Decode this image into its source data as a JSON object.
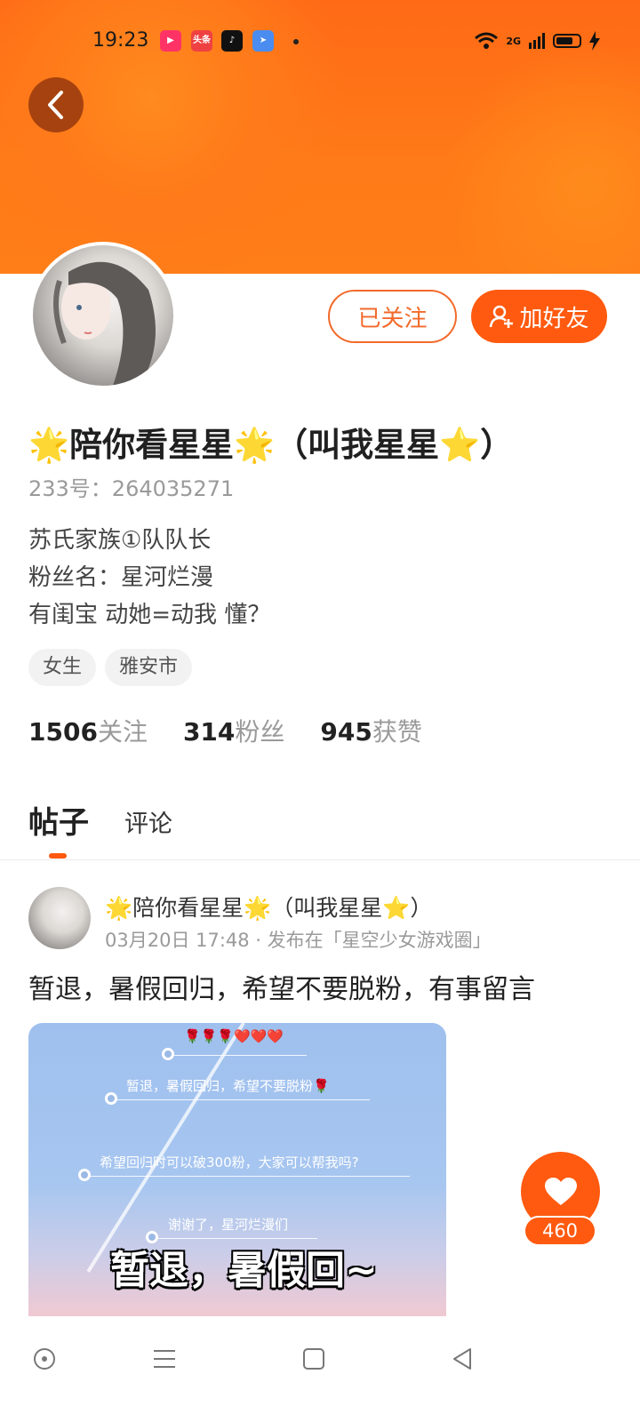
{
  "status_bar": {
    "time": "19:23",
    "network": "2G",
    "app_icons": [
      "video-app-icon",
      "toutiao-icon",
      "tiktok-icon",
      "maps-app-icon"
    ],
    "toutiao_label": "头条"
  },
  "profile": {
    "follow_button": "已关注",
    "add_friend_button": "加好友",
    "name": "🌟陪你看星星🌟（叫我星星⭐）",
    "uid": "233号：264035271",
    "bio": [
      "苏氏家族①队队长",
      "粉丝名：星河烂漫",
      "有闺宝 动她=动我 懂？"
    ],
    "tags": [
      "女生",
      "雅安市"
    ],
    "stats": [
      {
        "num": "1506",
        "label": "关注"
      },
      {
        "num": "314",
        "label": "粉丝"
      },
      {
        "num": "945",
        "label": "获赞"
      }
    ]
  },
  "tabs": {
    "posts": "帖子",
    "comments": "评论"
  },
  "post": {
    "author": "🌟陪你看星星🌟（叫我星星⭐）",
    "meta": "03月20日 17:48 · 发布在「星空少女游戏圈」",
    "title": "暂退，暑假回归，希望不要脱粉，有事留言",
    "image_lines": [
      "🌹🌹🌹❤️❤️❤️",
      "暂退，暑假回归，希望不要脱粉🌹",
      "希望回归时可以破300粉，大家可以帮我吗?",
      "谢谢了，星河烂漫们"
    ],
    "image_big_text": "暂退，暑假回~",
    "like_count": "460"
  },
  "colors": {
    "accent": "#ff5a0f",
    "banner": "#ff7518"
  }
}
